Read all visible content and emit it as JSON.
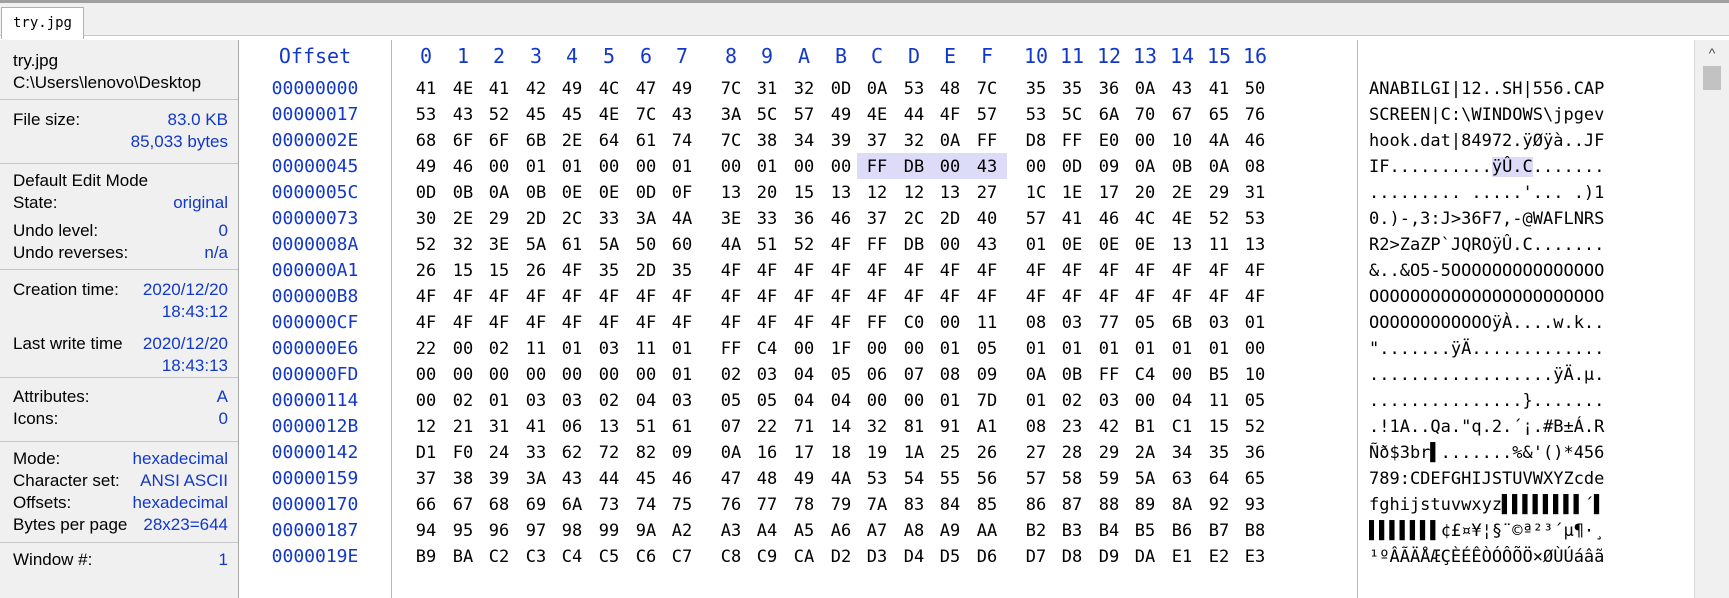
{
  "tab": {
    "label": "try.jpg"
  },
  "panel": {
    "file_name": "try.jpg",
    "file_path": "C:\\Users\\lenovo\\Desktop",
    "file_size_label": "File size:",
    "file_size_kb": "83.0 KB",
    "file_size_bytes": "85,033 bytes",
    "edit_mode_label": "Default Edit Mode",
    "state_label": "State:",
    "state_value": "original",
    "undo_level_label": "Undo level:",
    "undo_level_value": "0",
    "undo_reverses_label": "Undo reverses:",
    "undo_reverses_value": "n/a",
    "creation_label": "Creation time:",
    "creation_date": "2020/12/20",
    "creation_time": "18:43:12",
    "write_label": "Last write time",
    "write_date": "2020/12/20",
    "write_time": "18:43:13",
    "attributes_label": "Attributes:",
    "attributes_value": "A",
    "icons_label": "Icons:",
    "icons_value": "0",
    "mode_label": "Mode:",
    "mode_value": "hexadecimal",
    "charset_label": "Character set:",
    "charset_value": "ANSI ASCII",
    "offsets_label": "Offsets:",
    "offsets_value": "hexadecimal",
    "bpp_label": "Bytes per page",
    "bpp_value": "28x23=644",
    "window_label": "Window #:",
    "window_value": "1"
  },
  "hex": {
    "offset_header": "Offset",
    "columns": [
      "0",
      "1",
      "2",
      "3",
      "4",
      "5",
      "6",
      "7",
      "8",
      "9",
      "A",
      "B",
      "C",
      "D",
      "E",
      "F",
      "10",
      "11",
      "12",
      "13",
      "14",
      "15",
      "16"
    ],
    "rows": [
      {
        "offset": "00000000",
        "bytes": [
          "41",
          "4E",
          "41",
          "42",
          "49",
          "4C",
          "47",
          "49",
          "7C",
          "31",
          "32",
          "0D",
          "0A",
          "53",
          "48",
          "7C",
          "35",
          "35",
          "36",
          "0A",
          "43",
          "41",
          "50"
        ],
        "ascii": "ANABILGI|12..SH|556.CAP"
      },
      {
        "offset": "00000017",
        "bytes": [
          "53",
          "43",
          "52",
          "45",
          "45",
          "4E",
          "7C",
          "43",
          "3A",
          "5C",
          "57",
          "49",
          "4E",
          "44",
          "4F",
          "57",
          "53",
          "5C",
          "6A",
          "70",
          "67",
          "65",
          "76"
        ],
        "ascii": "SCREEN|C:\\WINDOWS\\jpgev"
      },
      {
        "offset": "0000002E",
        "bytes": [
          "68",
          "6F",
          "6F",
          "6B",
          "2E",
          "64",
          "61",
          "74",
          "7C",
          "38",
          "34",
          "39",
          "37",
          "32",
          "0A",
          "FF",
          "D8",
          "FF",
          "E0",
          "00",
          "10",
          "4A",
          "46"
        ],
        "ascii": "hook.dat|84972.ÿØÿà..JF"
      },
      {
        "offset": "00000045",
        "bytes": [
          "49",
          "46",
          "00",
          "01",
          "01",
          "00",
          "00",
          "01",
          "00",
          "01",
          "00",
          "00",
          "FF",
          "DB",
          "00",
          "43",
          "00",
          "0D",
          "09",
          "0A",
          "0B",
          "0A",
          "08"
        ],
        "ascii_pre": "IF..........",
        "ascii_hl": "ÿÛ.C",
        "ascii_post": ".......",
        "ascii": "IF..........ÿÛ.C......."
      },
      {
        "offset": "0000005C",
        "bytes": [
          "0D",
          "0B",
          "0A",
          "0B",
          "0E",
          "0E",
          "0D",
          "0F",
          "13",
          "20",
          "15",
          "13",
          "12",
          "12",
          "13",
          "27",
          "1C",
          "1E",
          "17",
          "20",
          "2E",
          "29",
          "31"
        ],
        "ascii": "......... .....'... .)1"
      },
      {
        "offset": "00000073",
        "bytes": [
          "30",
          "2E",
          "29",
          "2D",
          "2C",
          "33",
          "3A",
          "4A",
          "3E",
          "33",
          "36",
          "46",
          "37",
          "2C",
          "2D",
          "40",
          "57",
          "41",
          "46",
          "4C",
          "4E",
          "52",
          "53"
        ],
        "ascii": "0.)-,3:J>36F7,-@WAFLNRS"
      },
      {
        "offset": "0000008A",
        "bytes": [
          "52",
          "32",
          "3E",
          "5A",
          "61",
          "5A",
          "50",
          "60",
          "4A",
          "51",
          "52",
          "4F",
          "FF",
          "DB",
          "00",
          "43",
          "01",
          "0E",
          "0E",
          "0E",
          "13",
          "11",
          "13"
        ],
        "ascii": "R2>ZaZP`JQROÿÛ.C......."
      },
      {
        "offset": "000000A1",
        "bytes": [
          "26",
          "15",
          "15",
          "26",
          "4F",
          "35",
          "2D",
          "35",
          "4F",
          "4F",
          "4F",
          "4F",
          "4F",
          "4F",
          "4F",
          "4F",
          "4F",
          "4F",
          "4F",
          "4F",
          "4F",
          "4F",
          "4F"
        ],
        "ascii": "&..&O5-5OOOOOOOOOOOOOOO"
      },
      {
        "offset": "000000B8",
        "bytes": [
          "4F",
          "4F",
          "4F",
          "4F",
          "4F",
          "4F",
          "4F",
          "4F",
          "4F",
          "4F",
          "4F",
          "4F",
          "4F",
          "4F",
          "4F",
          "4F",
          "4F",
          "4F",
          "4F",
          "4F",
          "4F",
          "4F",
          "4F"
        ],
        "ascii": "OOOOOOOOOOOOOOOOOOOOOOO"
      },
      {
        "offset": "000000CF",
        "bytes": [
          "4F",
          "4F",
          "4F",
          "4F",
          "4F",
          "4F",
          "4F",
          "4F",
          "4F",
          "4F",
          "4F",
          "4F",
          "FF",
          "C0",
          "00",
          "11",
          "08",
          "03",
          "77",
          "05",
          "6B",
          "03",
          "01"
        ],
        "ascii": "OOOOOOOOOOOOÿÀ....w.k.."
      },
      {
        "offset": "000000E6",
        "bytes": [
          "22",
          "00",
          "02",
          "11",
          "01",
          "03",
          "11",
          "01",
          "FF",
          "C4",
          "00",
          "1F",
          "00",
          "00",
          "01",
          "05",
          "01",
          "01",
          "01",
          "01",
          "01",
          "01",
          "00"
        ],
        "ascii": "\".......ÿÄ............."
      },
      {
        "offset": "000000FD",
        "bytes": [
          "00",
          "00",
          "00",
          "00",
          "00",
          "00",
          "00",
          "01",
          "02",
          "03",
          "04",
          "05",
          "06",
          "07",
          "08",
          "09",
          "0A",
          "0B",
          "FF",
          "C4",
          "00",
          "B5",
          "10"
        ],
        "ascii": "..................ÿÄ.µ."
      },
      {
        "offset": "00000114",
        "bytes": [
          "00",
          "02",
          "01",
          "03",
          "03",
          "02",
          "04",
          "03",
          "05",
          "05",
          "04",
          "04",
          "00",
          "00",
          "01",
          "7D",
          "01",
          "02",
          "03",
          "00",
          "04",
          "11",
          "05"
        ],
        "ascii": "...............}......."
      },
      {
        "offset": "0000012B",
        "bytes": [
          "12",
          "21",
          "31",
          "41",
          "06",
          "13",
          "51",
          "61",
          "07",
          "22",
          "71",
          "14",
          "32",
          "81",
          "91",
          "A1",
          "08",
          "23",
          "42",
          "B1",
          "C1",
          "15",
          "52"
        ],
        "ascii": ".!1A..Qa.\"q.2.´¡.#B±Á.R"
      },
      {
        "offset": "00000142",
        "bytes": [
          "D1",
          "F0",
          "24",
          "33",
          "62",
          "72",
          "82",
          "09",
          "0A",
          "16",
          "17",
          "18",
          "19",
          "1A",
          "25",
          "26",
          "27",
          "28",
          "29",
          "2A",
          "34",
          "35",
          "36"
        ],
        "ascii": "Ñð$3br▌.......%&'()*456"
      },
      {
        "offset": "00000159",
        "bytes": [
          "37",
          "38",
          "39",
          "3A",
          "43",
          "44",
          "45",
          "46",
          "47",
          "48",
          "49",
          "4A",
          "53",
          "54",
          "55",
          "56",
          "57",
          "58",
          "59",
          "5A",
          "63",
          "64",
          "65"
        ],
        "ascii": "789:CDEFGHIJSTUVWXYZcde"
      },
      {
        "offset": "00000170",
        "bytes": [
          "66",
          "67",
          "68",
          "69",
          "6A",
          "73",
          "74",
          "75",
          "76",
          "77",
          "78",
          "79",
          "7A",
          "83",
          "84",
          "85",
          "86",
          "87",
          "88",
          "89",
          "8A",
          "92",
          "93"
        ],
        "ascii": "fghijstuvwxyz▌▌▌▌▌▌▌▌´▌"
      },
      {
        "offset": "00000187",
        "bytes": [
          "94",
          "95",
          "96",
          "97",
          "98",
          "99",
          "9A",
          "A2",
          "A3",
          "A4",
          "A5",
          "A6",
          "A7",
          "A8",
          "A9",
          "AA",
          "B2",
          "B3",
          "B4",
          "B5",
          "B6",
          "B7",
          "B8"
        ],
        "ascii": "▌▌▌▌▌▌▌¢£¤¥¦§¨©ª²³´µ¶·¸"
      },
      {
        "offset": "0000019E",
        "bytes": [
          "B9",
          "BA",
          "C2",
          "C3",
          "C4",
          "C5",
          "C6",
          "C7",
          "C8",
          "C9",
          "CA",
          "D2",
          "D3",
          "D4",
          "D5",
          "D6",
          "D7",
          "D8",
          "D9",
          "DA",
          "E1",
          "E2",
          "E3"
        ],
        "ascii": "¹ºÂÃÄÅÆÇÈÉÊÒÓÔÕÖ×ØÙÚáâã"
      }
    ]
  },
  "scrollbar": {
    "up_arrow": "^"
  },
  "colors": {
    "offset_blue": "#1238c8",
    "selection": "#dcdcf8"
  }
}
